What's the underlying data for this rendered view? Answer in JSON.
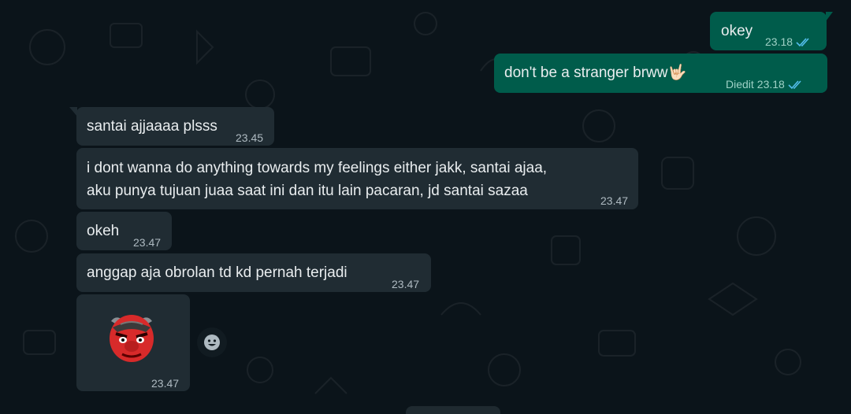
{
  "messages": [
    {
      "id": "m1",
      "direction": "out",
      "text": "okey",
      "time": "23.18",
      "status": "read"
    },
    {
      "id": "m2",
      "direction": "out",
      "text": "don't be a stranger brww",
      "emoji": "🤟🏻",
      "edited_label": "Diedit",
      "time": "23.18",
      "status": "read"
    },
    {
      "id": "m3",
      "direction": "in",
      "text": "santai ajjaaaa plsss",
      "time": "23.45"
    },
    {
      "id": "m4",
      "direction": "in",
      "line1": "i dont wanna do anything towards my feelings either jakk, santai ajaa,",
      "line2": "aku punya tujuan juaa saat ini dan itu lain pacaran, jd santai sazaa",
      "time": "23.47"
    },
    {
      "id": "m5",
      "direction": "in",
      "text": "okeh",
      "time": "23.47"
    },
    {
      "id": "m6",
      "direction": "in",
      "text": "anggap aja obrolan td kd pernah terjadi",
      "time": "23.47"
    },
    {
      "id": "m7",
      "direction": "in",
      "sticker": "red-ogre-emoji",
      "time": "23.47"
    }
  ],
  "colors": {
    "outgoing": "#005c4b",
    "incoming": "#202c33",
    "background": "#0b141a",
    "read_ticks": "#53bdeb"
  }
}
